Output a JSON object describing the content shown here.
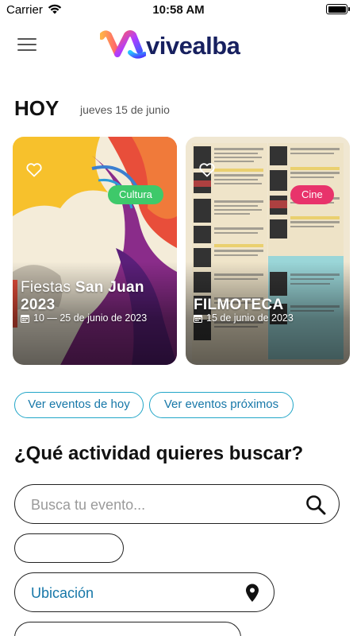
{
  "status_bar": {
    "carrier": "Carrier",
    "time": "10:58 AM"
  },
  "header": {
    "logo_text": "vivealba",
    "menu_icon": "hamburger-icon"
  },
  "today": {
    "title": "HOY",
    "date": "jueves 15 de junio"
  },
  "events": [
    {
      "title_plain": "Fiestas ",
      "title_bold": "San Juan 2023",
      "date": "10 — 25 de junio de 2023",
      "category": "Cultura",
      "category_color": "#3ec96a",
      "favorite": false
    },
    {
      "title_plain": "",
      "title_bold": "FILMOTECA",
      "date": "15 de junio de 2023",
      "category": "Cine",
      "category_color": "#e8336b",
      "favorite": false
    }
  ],
  "filters": {
    "today_label": "Ver eventos de hoy",
    "upcoming_label": "Ver eventos próximos"
  },
  "search": {
    "heading": "¿Qué actividad quieres buscar?",
    "placeholder": "Busca tu evento...",
    "value": "",
    "location_label": "Ubicación"
  },
  "colors": {
    "accent": "#22a6c8",
    "link_text": "#1677a8",
    "logo_text": "#17205f"
  }
}
